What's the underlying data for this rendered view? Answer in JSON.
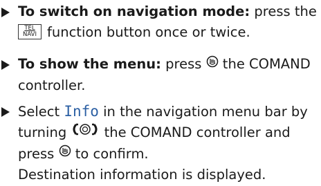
{
  "steps": [
    {
      "bold": "To switch on navigation mode:",
      "text_a": " press the",
      "key_top": "TEL",
      "key_bottom": "NAVI",
      "text_b": "function button once or twice."
    },
    {
      "bold": "To show the menu:",
      "text_a": " press",
      "text_b": " the COMAND",
      "text_c": "controller."
    },
    {
      "text_a": "Select ",
      "info_word": "Info",
      "text_b": " in the navigation menu bar by",
      "text_c": "turning",
      "text_d": " the COMAND controller and",
      "text_e": "press",
      "text_f": " to confirm.",
      "result": "Destination information is displayed."
    }
  ]
}
